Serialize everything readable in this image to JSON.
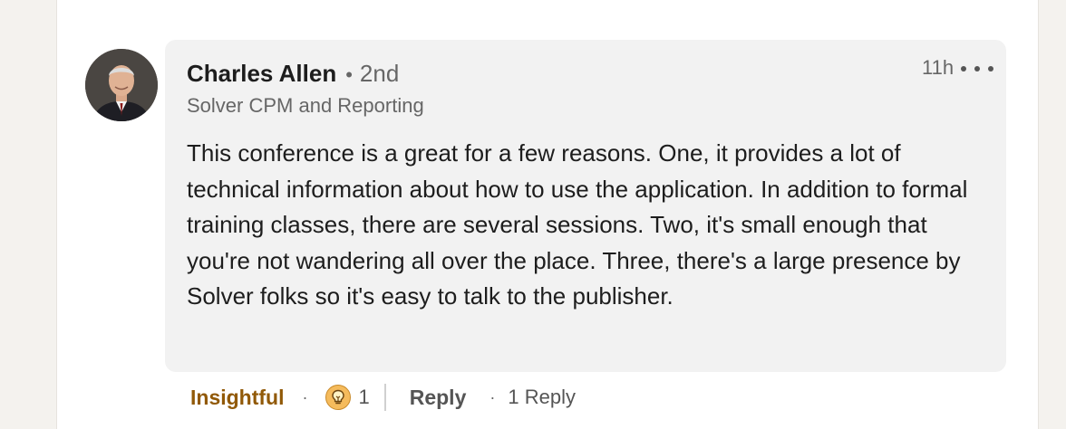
{
  "comment": {
    "author": "Charles Allen",
    "separator": "•",
    "connection_degree": "2nd",
    "headline": "Solver CPM and Reporting",
    "timestamp": "11h",
    "text": "This conference is a great for a few reasons. One, it provides a lot of technical information about how to use the application. In addition to formal training classes, there are several sessions. Two, it's small enough that you're not wandering all over the place. Three, there's a large presence by Solver folks so it's easy to talk to the publisher."
  },
  "actions": {
    "reaction_label": "Insightful",
    "dot": "·",
    "reaction_icon": "lightbulb-icon",
    "reaction_count": "1",
    "reply_label": "Reply",
    "replies_count": "1 Reply"
  },
  "colors": {
    "insightful": "#915907",
    "bubble": "#f2f2f2",
    "page_background": "#f4f2ee",
    "reaction_icon_fill": "#f5bb5c"
  }
}
